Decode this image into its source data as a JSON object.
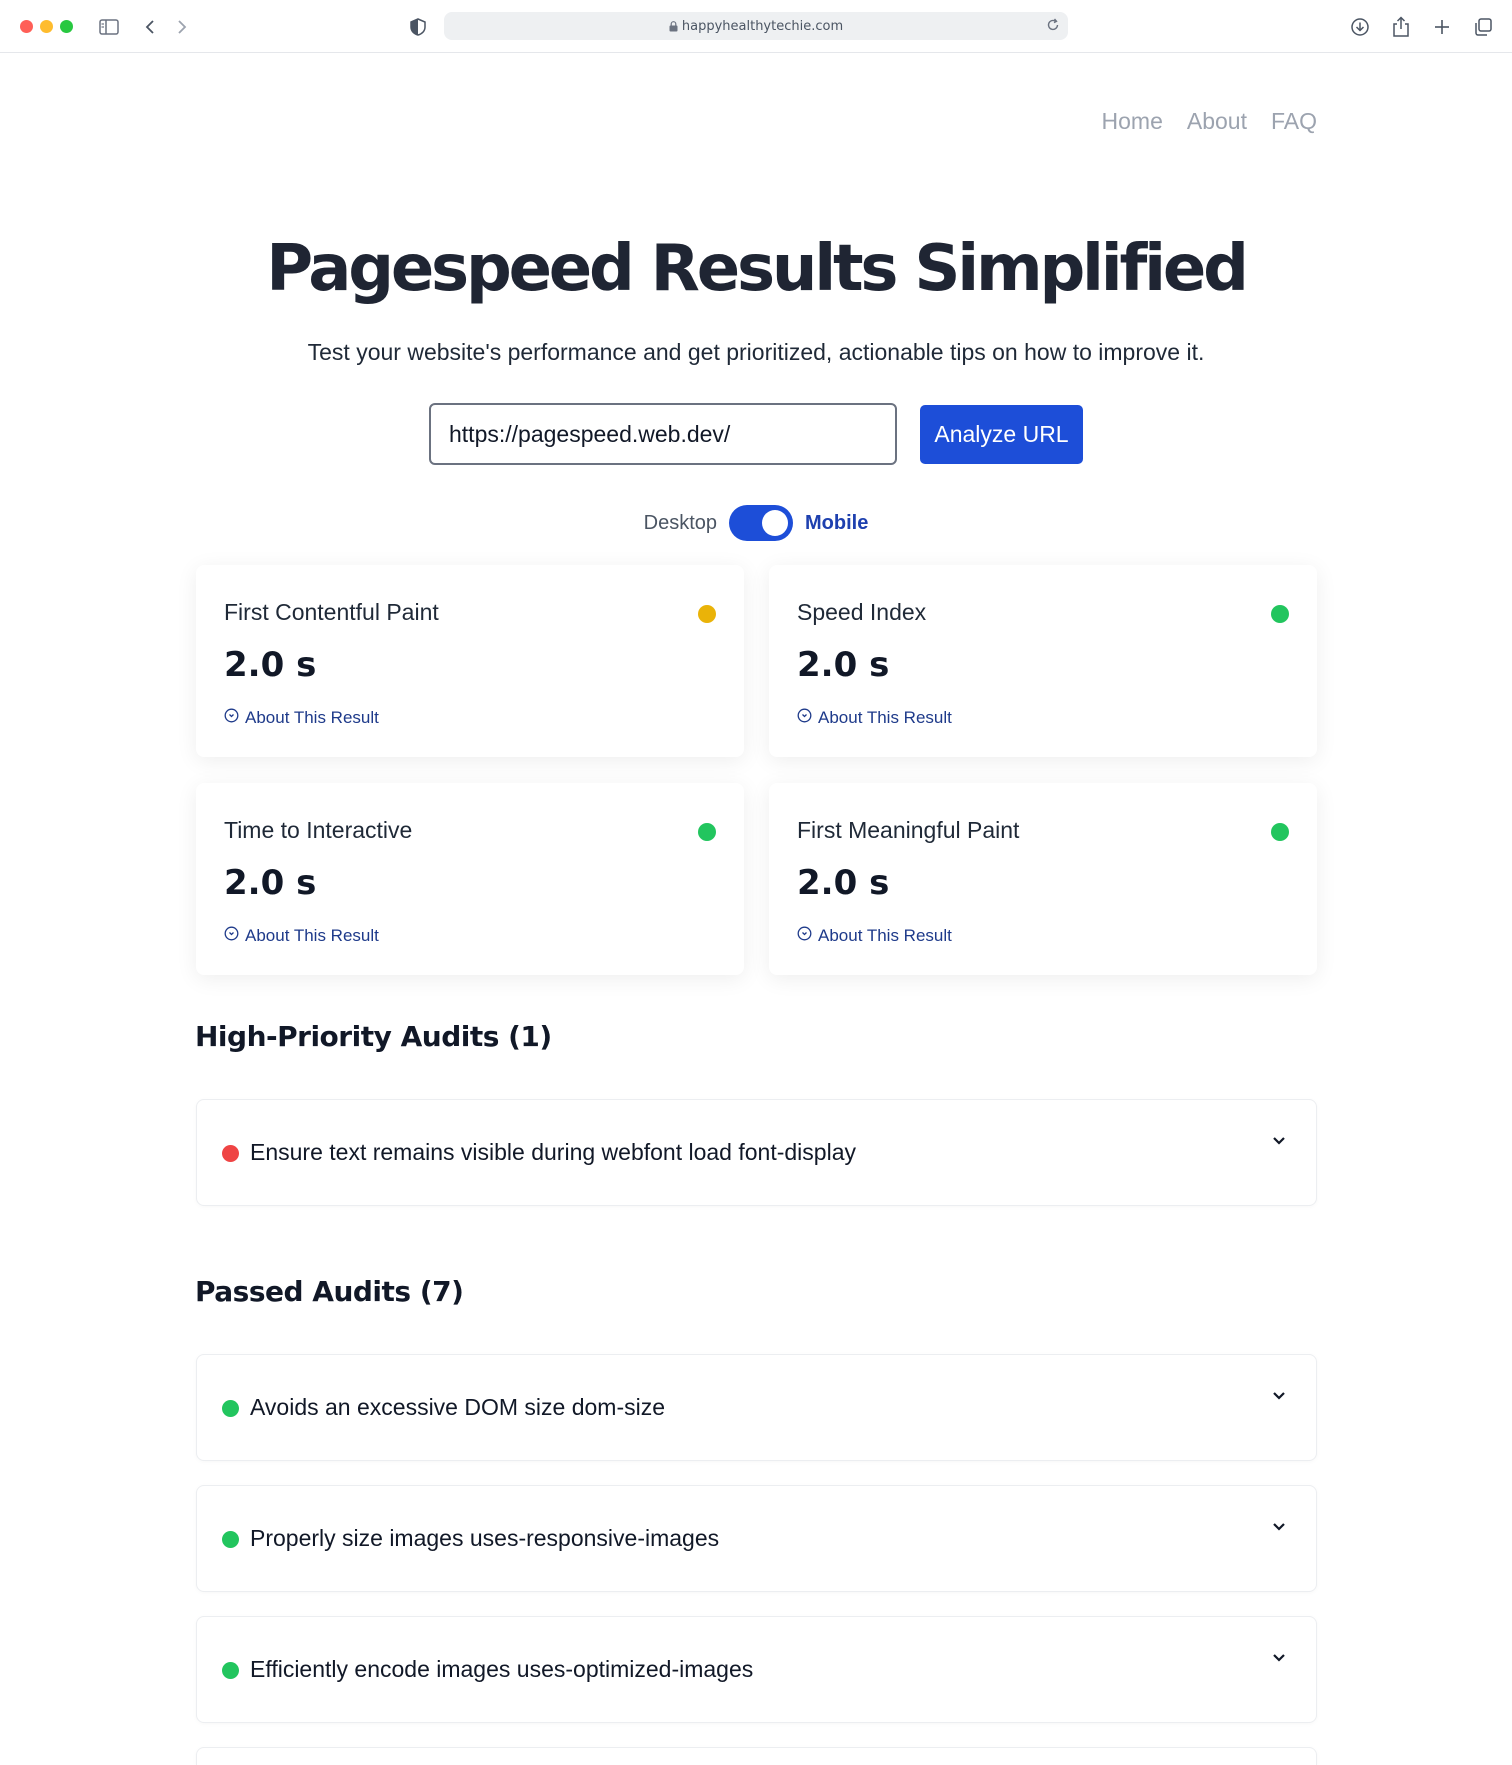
{
  "browser": {
    "address": "happyhealthytechie.com",
    "icons": [
      "sidebar-icon",
      "back-icon",
      "forward-icon",
      "shield-icon",
      "lock-icon",
      "reload-icon",
      "download-icon",
      "share-icon",
      "new-tab-icon",
      "tabs-overview-icon"
    ]
  },
  "nav": {
    "home": "Home",
    "about": "About",
    "faq": "FAQ"
  },
  "hero": {
    "title": "Pagespeed Results Simplified",
    "subtitle": "Test your website's performance and get prioritized, actionable tips on how to improve it."
  },
  "form": {
    "url_value": "https://pagespeed.web.dev/",
    "analyze_label": "Analyze URL"
  },
  "device_toggle": {
    "left": "Desktop",
    "right": "Mobile",
    "selected": "Mobile"
  },
  "metrics": [
    {
      "name": "First Contentful Paint",
      "value": "2.0 s",
      "status": "average",
      "color": "#eab308",
      "link": "About This Result"
    },
    {
      "name": "Speed Index",
      "value": "2.0 s",
      "status": "good",
      "color": "#22c55e",
      "link": "About This Result"
    },
    {
      "name": "Time to Interactive",
      "value": "2.0 s",
      "status": "good",
      "color": "#22c55e",
      "link": "About This Result"
    },
    {
      "name": "First Meaningful Paint",
      "value": "2.0 s",
      "status": "good",
      "color": "#22c55e",
      "link": "About This Result"
    }
  ],
  "high_priority": {
    "title": "High-Priority Audits (1)",
    "items": [
      {
        "text": "Ensure text remains visible during webfont load font-display",
        "color": "#ef4444"
      }
    ]
  },
  "passed": {
    "title": "Passed Audits (7)",
    "items": [
      {
        "text": "Avoids an excessive DOM size dom-size",
        "color": "#22c55e"
      },
      {
        "text": "Properly size images uses-responsive-images",
        "color": "#22c55e"
      },
      {
        "text": "Efficiently encode images uses-optimized-images",
        "color": "#22c55e"
      }
    ]
  }
}
